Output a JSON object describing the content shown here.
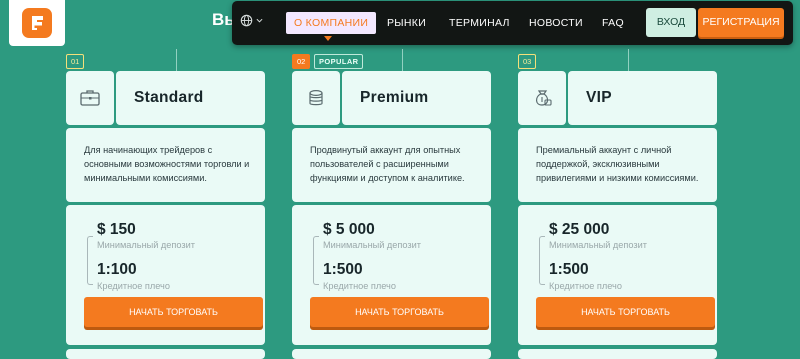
{
  "header": {
    "hero_title": "Вы",
    "nav": {
      "items": [
        {
          "label": "О КОМПАНИИ",
          "active": true
        },
        {
          "label": "РЫНКИ",
          "active": false
        },
        {
          "label": "ТЕРМИНАЛ",
          "active": false
        },
        {
          "label": "НОВОСТИ",
          "active": false
        },
        {
          "label": "FAQ",
          "active": false
        }
      ],
      "login_label": "ВХОД",
      "register_label": "РЕГИСТРАЦИЯ"
    }
  },
  "plans": [
    {
      "number": "01",
      "tag": "",
      "icon": "briefcase-icon",
      "name": "Standard",
      "description": "Для начинающих трейдеров с основными возможностями торговли и минимальными комиссиями.",
      "deposit": "$ 150",
      "deposit_label": "Минимальный депозит",
      "leverage": "1:100",
      "leverage_label": "Кредитное плечо",
      "button_label": "НАЧАТЬ ТОРГОВАТЬ"
    },
    {
      "number": "02",
      "tag": "POPULAR",
      "icon": "coins-icon",
      "name": "Premium",
      "description": "Продвинутый аккаунт для опытных пользователей с расширенными функциями и доступом к аналитике.",
      "deposit": "$ 5 000",
      "deposit_label": "Минимальный депозит",
      "leverage": "1:500",
      "leverage_label": "Кредитное плечо",
      "button_label": "НАЧАТЬ ТОРГОВАТЬ"
    },
    {
      "number": "03",
      "tag": "",
      "icon": "money-bag-icon",
      "name": "VIP",
      "description": "Премиальный аккаунт с личной поддержкой, эксклюзивными привилегиями и низкими комиссиями.",
      "deposit": "$ 25 000",
      "deposit_label": "Минимальный депозит",
      "leverage": "1:500",
      "leverage_label": "Кредитное плечо",
      "button_label": "НАЧАТЬ ТОРГОВАТЬ"
    }
  ],
  "colors": {
    "background": "#2d9a80",
    "accent": "#f47a1f",
    "card": "#eafaf6",
    "navbar": "#121614"
  }
}
